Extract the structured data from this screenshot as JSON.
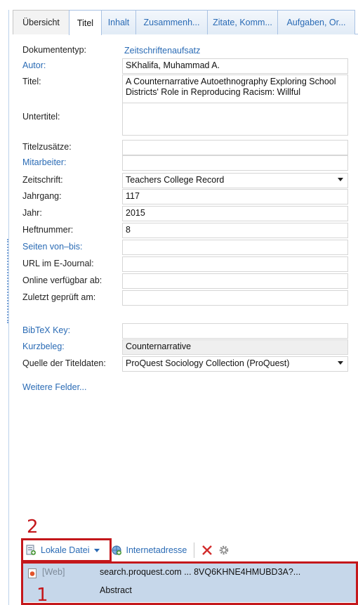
{
  "tabs": [
    {
      "label": "Übersicht"
    },
    {
      "label": "Titel"
    },
    {
      "label": "Inhalt"
    },
    {
      "label": "Zusammenh..."
    },
    {
      "label": "Zitate, Komm..."
    },
    {
      "label": "Aufgaben, Or..."
    }
  ],
  "fields": {
    "dokumententyp": {
      "label": "Dokumententyp:",
      "value": "Zeitschriftenaufsatz"
    },
    "autor": {
      "label": "Autor:",
      "value": "SKhalifa, Muhammad A."
    },
    "titel": {
      "label": "Titel:",
      "value": "A Counternarrative Autoethnography Exploring School Districts' Role in Reproducing Racism: Willful"
    },
    "untertitel": {
      "label": "Untertitel:",
      "value": ""
    },
    "titelzusaetze": {
      "label": "Titelzusätze:",
      "value": ""
    },
    "mitarbeiter": {
      "label": "Mitarbeiter:",
      "value": ""
    },
    "zeitschrift": {
      "label": "Zeitschrift:",
      "value": "Teachers College Record"
    },
    "jahrgang": {
      "label": "Jahrgang:",
      "value": "117"
    },
    "jahr": {
      "label": "Jahr:",
      "value": "2015"
    },
    "heftnummer": {
      "label": "Heftnummer:",
      "value": "8"
    },
    "seiten": {
      "label": "Seiten von–bis:",
      "value": ""
    },
    "url": {
      "label": "URL im E-Journal:",
      "value": ""
    },
    "online": {
      "label": "Online verfügbar ab:",
      "value": ""
    },
    "zuletzt": {
      "label": "Zuletzt geprüft am:",
      "value": ""
    },
    "bibtex": {
      "label": "BibTeX Key:",
      "value": ""
    },
    "kurzbeleg": {
      "label": "Kurzbeleg:",
      "value": "Counternarrative"
    },
    "quelle": {
      "label": "Quelle der Titeldaten:",
      "value": "ProQuest Sociology Collection (ProQuest)"
    }
  },
  "weitere_felder": "Weitere Felder...",
  "toolbar": {
    "local_file": "Lokale Datei",
    "internet_address": "Internetadresse"
  },
  "attachment": {
    "type": "[Web]",
    "url": "search.proquest.com ... 8VQ6KHNE4HMUBD3A?...",
    "title": "Abstract"
  },
  "annotations": {
    "box1": "1",
    "box2": "2"
  },
  "colors": {
    "link": "#2a6bb5",
    "annotation": "#c4171b",
    "selection": "#c6d7ea"
  }
}
